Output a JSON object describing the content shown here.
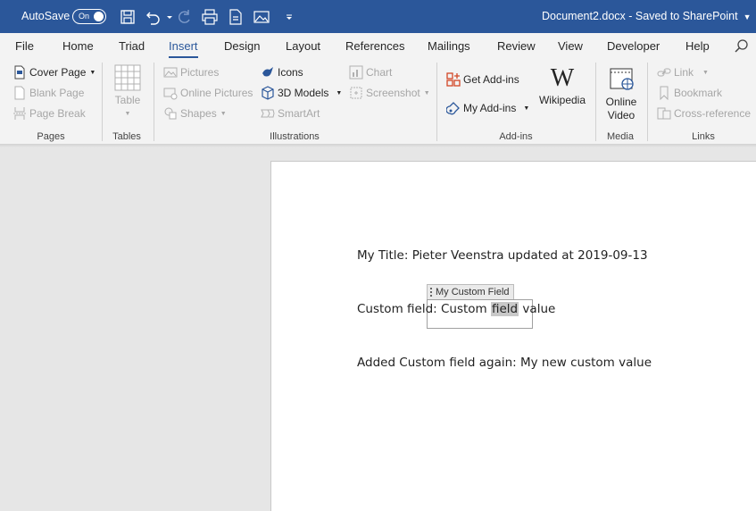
{
  "titlebar": {
    "autosave_label": "AutoSave",
    "toggle_label": "On",
    "doc_title": "Document2.docx  -  Saved to SharePoint",
    "background": "#2b579a"
  },
  "tabs": [
    {
      "label": "File"
    },
    {
      "label": "Home"
    },
    {
      "label": "Triad"
    },
    {
      "label": "Insert",
      "active": true
    },
    {
      "label": "Design"
    },
    {
      "label": "Layout"
    },
    {
      "label": "References"
    },
    {
      "label": "Mailings"
    },
    {
      "label": "Review"
    },
    {
      "label": "View"
    },
    {
      "label": "Developer"
    },
    {
      "label": "Help"
    }
  ],
  "ribbon": {
    "pages": {
      "label": "Pages",
      "cover_page": "Cover Page",
      "blank_page": "Blank Page",
      "page_break": "Page Break"
    },
    "tables": {
      "label": "Tables",
      "table": "Table"
    },
    "illustrations": {
      "label": "Illustrations",
      "pictures": "Pictures",
      "online_pictures": "Online Pictures",
      "shapes": "Shapes",
      "icons": "Icons",
      "models_3d": "3D Models",
      "smartart": "SmartArt",
      "chart": "Chart",
      "screenshot": "Screenshot"
    },
    "addins": {
      "label": "Add-ins",
      "get_addins": "Get Add-ins",
      "my_addins": "My Add-ins",
      "wikipedia": "Wikipedia"
    },
    "media": {
      "label": "Media",
      "online_video_line1": "Online",
      "online_video_line2": "Video"
    },
    "links": {
      "label": "Links",
      "link": "Link",
      "bookmark": "Bookmark",
      "cross_reference": "Cross-reference"
    }
  },
  "document": {
    "title_line": "My Title: Pieter Veenstra updated at 2019-09-13",
    "custom_field_prefix": "Custom field: ",
    "content_control_tag": "My Custom Field",
    "cc_value_before": "Custom ",
    "cc_value_highlight": "field",
    "cc_value_after": " value",
    "added_line": "Added Custom field again: My new custom value"
  },
  "colors": {
    "accent": "#2b579a",
    "ribbon_bg": "#f3f3f3",
    "workspace_bg": "#e6e6e6",
    "get_addins_icon": "#d24726",
    "addins_icon": "#2b579a"
  }
}
